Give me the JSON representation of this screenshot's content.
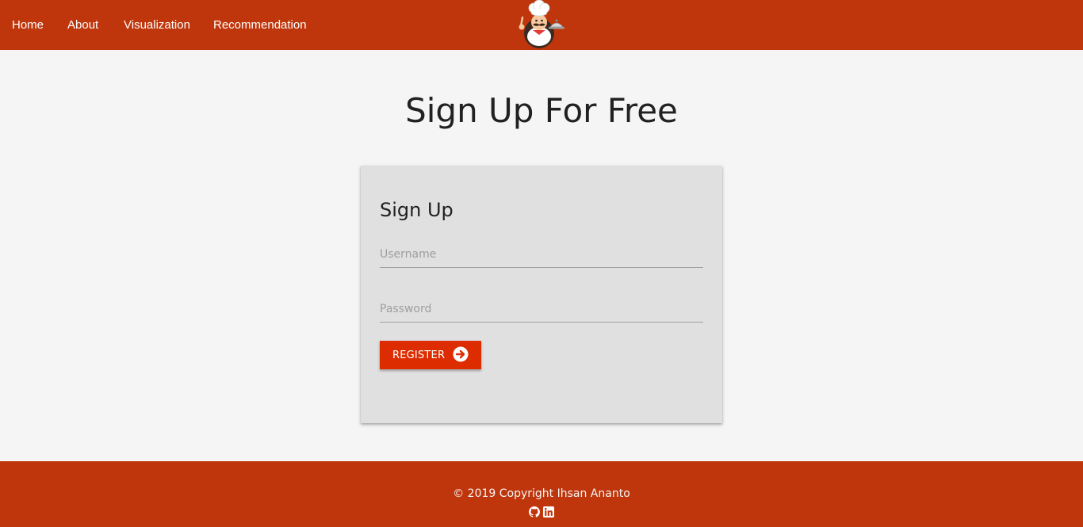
{
  "nav": {
    "items": [
      {
        "label": "Home"
      },
      {
        "label": "About"
      },
      {
        "label": "Visualization"
      },
      {
        "label": "Recommendation"
      }
    ],
    "logo_icon": "chef-logo-icon"
  },
  "main": {
    "title": "Sign Up For Free"
  },
  "form": {
    "title": "Sign Up",
    "username": {
      "placeholder": "Username",
      "value": ""
    },
    "password": {
      "placeholder": "Password",
      "value": ""
    },
    "submit_label": "REGISTER",
    "submit_icon": "arrow-circle-right-icon"
  },
  "footer": {
    "copyright": "© 2019 Copyright Ihsan Ananto",
    "social_icons": [
      "github-icon",
      "linkedin-icon"
    ]
  },
  "colors": {
    "primary": "#bf360c",
    "button": "#dd2c00",
    "background": "#f5f5f5",
    "card": "#e0e0e0"
  }
}
